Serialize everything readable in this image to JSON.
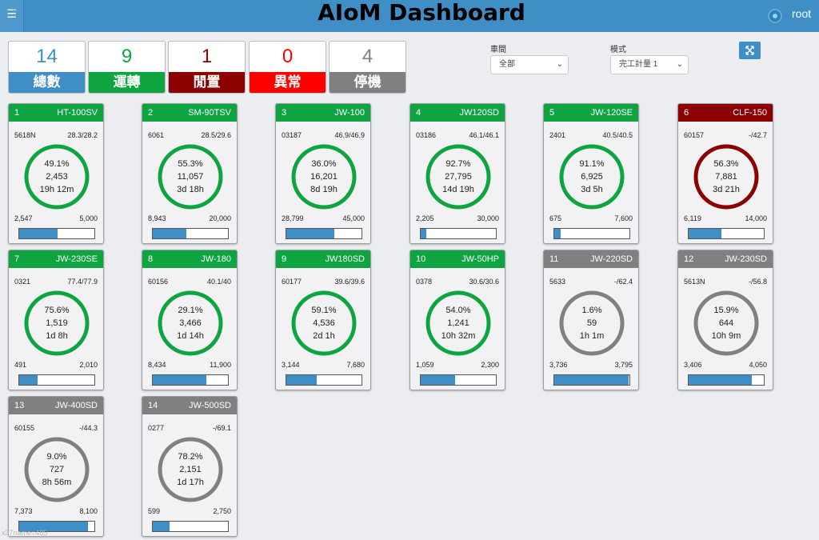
{
  "header": {
    "menu_icon": "hamburger-icon",
    "title": "AIoM Dashboard",
    "user": "root"
  },
  "colors": {
    "green": "#0ea541",
    "darkred": "#8b0000",
    "red": "#ff0000",
    "gray": "#808080",
    "blue": "#3f8fc6"
  },
  "stats": [
    {
      "value": "14",
      "label": "總數",
      "color": "#3f8fc6"
    },
    {
      "value": "9",
      "label": "運轉",
      "color": "#0ea541"
    },
    {
      "value": "1",
      "label": "閒置",
      "color": "#8b0000"
    },
    {
      "value": "0",
      "label": "異常",
      "color": "#ff0000"
    },
    {
      "value": "4",
      "label": "停機",
      "color": "#808080"
    }
  ],
  "filters": {
    "workshop": {
      "label": "車間",
      "value": "全部"
    },
    "mode": {
      "label": "模式",
      "value": "完工計量 1"
    }
  },
  "fullscreen_icon": "fullscreen-icon",
  "machines": [
    {
      "id": "1",
      "name": "HT-100SV",
      "status": "running",
      "code": "5618N",
      "cycle": "28.3/28.2",
      "pct": "49.1%",
      "count": "2,453",
      "time": "19h 12m",
      "done": "2,547",
      "target": "5,000",
      "progress": 0.509
    },
    {
      "id": "2",
      "name": "SM-90TSV",
      "status": "running",
      "code": "6061",
      "cycle": "28.5/29.6",
      "pct": "55.3%",
      "count": "11,057",
      "time": "3d 18h",
      "done": "8,943",
      "target": "20,000",
      "progress": 0.447
    },
    {
      "id": "3",
      "name": "JW-100",
      "status": "running",
      "code": "03187",
      "cycle": "46.9/46.9",
      "pct": "36.0%",
      "count": "16,201",
      "time": "8d 19h",
      "done": "28,799",
      "target": "45,000",
      "progress": 0.64
    },
    {
      "id": "4",
      "name": "JW120SD",
      "status": "running",
      "code": "03186",
      "cycle": "46.1/46.1",
      "pct": "92.7%",
      "count": "27,795",
      "time": "14d 19h",
      "done": "2,205",
      "target": "30,000",
      "progress": 0.074
    },
    {
      "id": "5",
      "name": "JW-120SE",
      "status": "running",
      "code": "2401",
      "cycle": "40.5/40.5",
      "pct": "91.1%",
      "count": "6,925",
      "time": "3d 5h",
      "done": "675",
      "target": "7,600",
      "progress": 0.089
    },
    {
      "id": "6",
      "name": "CLF-150",
      "status": "idle",
      "code": "60157",
      "cycle": "-/42.7",
      "pct": "56.3%",
      "count": "7,881",
      "time": "3d 21h",
      "done": "6,119",
      "target": "14,000",
      "progress": 0.437
    },
    {
      "id": "7",
      "name": "JW-230SE",
      "status": "running",
      "code": "0321",
      "cycle": "77.4/77.9",
      "pct": "75.6%",
      "count": "1,519",
      "time": "1d 8h",
      "done": "491",
      "target": "2,010",
      "progress": 0.244
    },
    {
      "id": "8",
      "name": "JW-180",
      "status": "running",
      "code": "60156",
      "cycle": "40.1/40",
      "pct": "29.1%",
      "count": "3,466",
      "time": "1d 14h",
      "done": "8,434",
      "target": "11,900",
      "progress": 0.709
    },
    {
      "id": "9",
      "name": "JW180SD",
      "status": "running",
      "code": "60177",
      "cycle": "39.6/39.6",
      "pct": "59.1%",
      "count": "4,536",
      "time": "2d 1h",
      "done": "3,144",
      "target": "7,680",
      "progress": 0.409
    },
    {
      "id": "10",
      "name": "JW-50HP",
      "status": "running",
      "code": "0378",
      "cycle": "30.6/30.6",
      "pct": "54.0%",
      "count": "1,241",
      "time": "10h 32m",
      "done": "1,059",
      "target": "2,300",
      "progress": 0.46
    },
    {
      "id": "11",
      "name": "JW-220SD",
      "status": "stopped",
      "code": "5633",
      "cycle": "-/62.4",
      "pct": "1.6%",
      "count": "59",
      "time": "1h 1m",
      "done": "3,736",
      "target": "3,795",
      "progress": 0.984
    },
    {
      "id": "12",
      "name": "JW-230SD",
      "status": "stopped",
      "code": "5613N",
      "cycle": "-/56.8",
      "pct": "15.9%",
      "count": "644",
      "time": "10h 9m",
      "done": "3,406",
      "target": "4,050",
      "progress": 0.841
    },
    {
      "id": "13",
      "name": "JW-400SD",
      "status": "stopped",
      "code": "60155",
      "cycle": "-/44.3",
      "pct": "9.0%",
      "count": "727",
      "time": "8h 56m",
      "done": "7,373",
      "target": "8,100",
      "progress": 0.91
    },
    {
      "id": "14",
      "name": "JW-500SD",
      "status": "stopped",
      "code": "0277",
      "cycle": "-/69.1",
      "pct": "78.2%",
      "count": "2,151",
      "time": "1d 17h",
      "done": "599",
      "target": "2,750",
      "progress": 0.218
    }
  ],
  "watermark": "x37name=485"
}
